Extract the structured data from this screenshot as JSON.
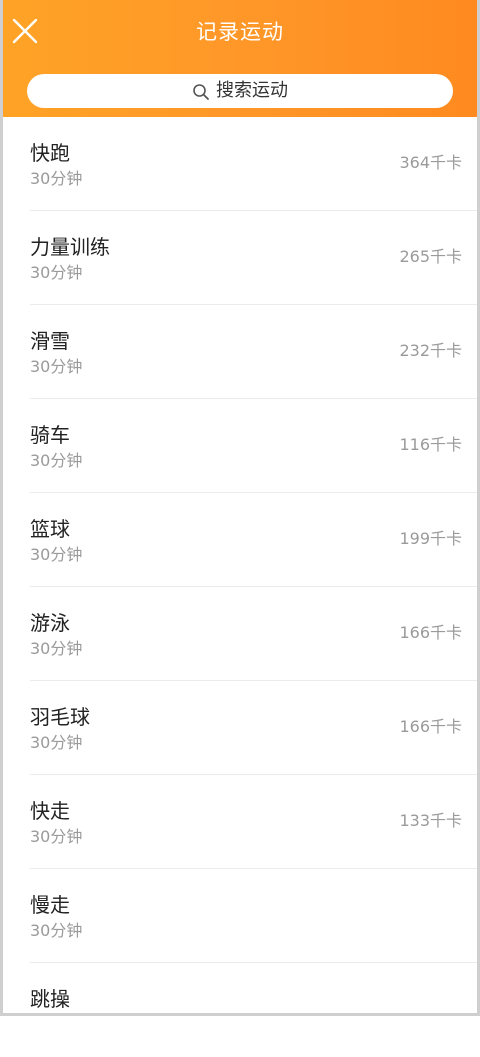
{
  "header": {
    "title": "记录运动",
    "close_icon": "close-icon",
    "gradient_colors": [
      "#ffa326",
      "#ff8a1f"
    ]
  },
  "search": {
    "icon": "search-icon",
    "placeholder": "搜索运动"
  },
  "activities": [
    {
      "name": "快跑",
      "duration": "30分钟",
      "calories": "364千卡"
    },
    {
      "name": "力量训练",
      "duration": "30分钟",
      "calories": "265千卡"
    },
    {
      "name": "滑雪",
      "duration": "30分钟",
      "calories": "232千卡"
    },
    {
      "name": "骑车",
      "duration": "30分钟",
      "calories": "116千卡"
    },
    {
      "name": "篮球",
      "duration": "30分钟",
      "calories": "199千卡"
    },
    {
      "name": "游泳",
      "duration": "30分钟",
      "calories": "166千卡"
    },
    {
      "name": "羽毛球",
      "duration": "30分钟",
      "calories": "166千卡"
    },
    {
      "name": "快走",
      "duration": "30分钟",
      "calories": "133千卡"
    },
    {
      "name": "慢走",
      "duration": "30分钟",
      "calories": ""
    },
    {
      "name": "跳操",
      "duration": "",
      "calories": ""
    }
  ]
}
